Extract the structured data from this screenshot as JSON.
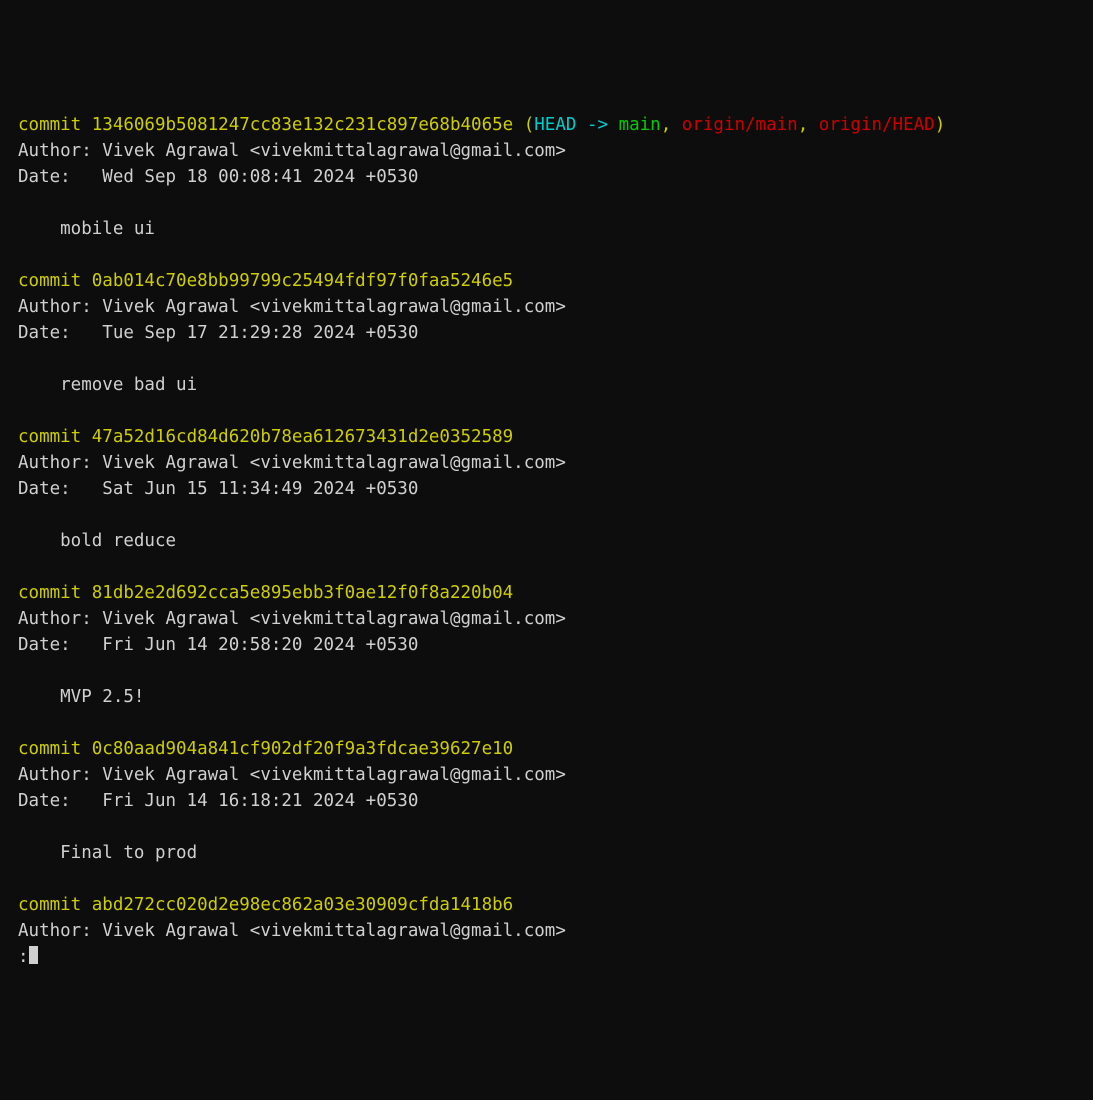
{
  "refs": {
    "open": "(",
    "head": "HEAD -> ",
    "main": "main",
    "sep1": ", ",
    "origin_main": "origin/main",
    "sep2": ", ",
    "origin_head": "origin/HEAD",
    "close": ")"
  },
  "commits": [
    {
      "hash": "1346069b5081247cc83e132c231c897e68b4065e",
      "author": "Vivek Agrawal <vivekmittalagrawal@gmail.com>",
      "date": "Wed Sep 18 00:08:41 2024 +0530",
      "message": "mobile ui",
      "has_refs": true
    },
    {
      "hash": "0ab014c70e8bb99799c25494fdf97f0faa5246e5",
      "author": "Vivek Agrawal <vivekmittalagrawal@gmail.com>",
      "date": "Tue Sep 17 21:29:28 2024 +0530",
      "message": "remove bad ui",
      "has_refs": false
    },
    {
      "hash": "47a52d16cd84d620b78ea612673431d2e0352589",
      "author": "Vivek Agrawal <vivekmittalagrawal@gmail.com>",
      "date": "Sat Jun 15 11:34:49 2024 +0530",
      "message": "bold reduce",
      "has_refs": false
    },
    {
      "hash": "81db2e2d692cca5e895ebb3f0ae12f0f8a220b04",
      "author": "Vivek Agrawal <vivekmittalagrawal@gmail.com>",
      "date": "Fri Jun 14 20:58:20 2024 +0530",
      "message": "MVP 2.5!",
      "has_refs": false
    },
    {
      "hash": "0c80aad904a841cf902df20f9a3fdcae39627e10",
      "author": "Vivek Agrawal <vivekmittalagrawal@gmail.com>",
      "date": "Fri Jun 14 16:18:21 2024 +0530",
      "message": "Final to prod",
      "has_refs": false
    },
    {
      "hash": "abd272cc020d2e98ec862a03e30909cfda1418b6",
      "author": "Vivek Agrawal <vivekmittalagrawal@gmail.com>",
      "date": null,
      "message": null,
      "has_refs": false
    }
  ],
  "labels": {
    "commit": "commit ",
    "author": "Author: ",
    "date": "Date:   "
  },
  "pager_prompt": ":"
}
